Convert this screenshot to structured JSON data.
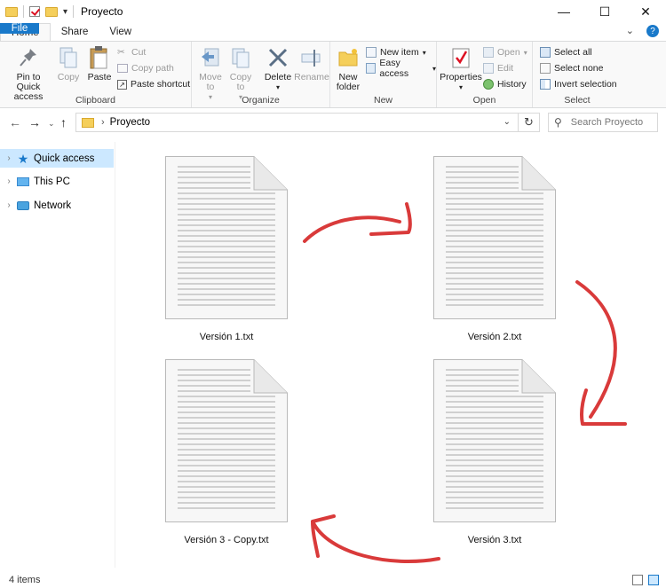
{
  "window": {
    "title": "Proyecto"
  },
  "ribbon_tabs": [
    "File",
    "Home",
    "Share",
    "View"
  ],
  "clipboard": {
    "label": "Clipboard",
    "pin": "Pin to Quick access",
    "copy": "Copy",
    "paste": "Paste",
    "cut": "Cut",
    "copy_path": "Copy path",
    "paste_shortcut": "Paste shortcut"
  },
  "organize": {
    "label": "Organize",
    "move_to": "Move to",
    "copy_to": "Copy to",
    "delete": "Delete",
    "rename": "Rename"
  },
  "new_group": {
    "label": "New",
    "new_folder": "New folder",
    "new_item": "New item",
    "easy_access": "Easy access"
  },
  "open_group": {
    "label": "Open",
    "properties": "Properties",
    "open": "Open",
    "edit": "Edit",
    "history": "History"
  },
  "select_group": {
    "label": "Select",
    "select_all": "Select all",
    "select_none": "Select none",
    "invert": "Invert selection"
  },
  "address": {
    "crumb": "Proyecto",
    "search_placeholder": "Search Proyecto"
  },
  "sidebar": [
    {
      "label": "Quick access",
      "icon": "star-icon"
    },
    {
      "label": "This PC",
      "icon": "pc-icon"
    },
    {
      "label": "Network",
      "icon": "network-icon"
    }
  ],
  "files": [
    {
      "name": "Versión 1.txt"
    },
    {
      "name": "Versión 2.txt"
    },
    {
      "name": "Versión 3 - Copy.txt"
    },
    {
      "name": "Versión 3.txt"
    }
  ],
  "status": {
    "count": "4 items"
  },
  "colors": {
    "accent": "#1979ca",
    "arrow": "#d93a3a",
    "selection": "#cce8ff"
  }
}
